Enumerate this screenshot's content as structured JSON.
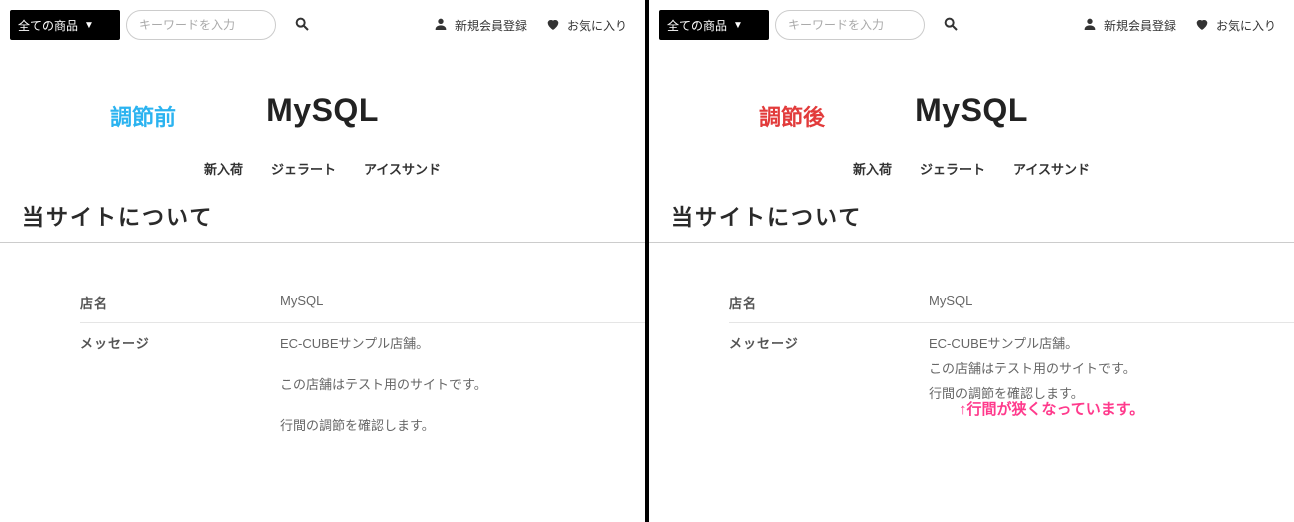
{
  "left": {
    "annotation": "調節前",
    "topbar": {
      "category_label": "全ての商品",
      "search_placeholder": "キーワードを入力",
      "register_label": "新規会員登録",
      "favorites_label": "お気に入り"
    },
    "brand": "MySQL",
    "nav": [
      "新入荷",
      "ジェラート",
      "アイスサンド"
    ],
    "page_title": "当サイトについて",
    "rows": {
      "shop_name_label": "店名",
      "shop_name_value": "MySQL",
      "message_label": "メッセージ",
      "message_lines": [
        "EC-CUBEサンプル店舗。",
        "この店舗はテスト用のサイトです。",
        "行間の調節を確認します。"
      ]
    }
  },
  "right": {
    "annotation": "調節後",
    "annotation2": "↑行間が狭くなっています。",
    "topbar": {
      "category_label": "全ての商品",
      "search_placeholder": "キーワードを入力",
      "register_label": "新規会員登録",
      "favorites_label": "お気に入り"
    },
    "brand": "MySQL",
    "nav": [
      "新入荷",
      "ジェラート",
      "アイスサンド"
    ],
    "page_title": "当サイトについて",
    "rows": {
      "shop_name_label": "店名",
      "shop_name_value": "MySQL",
      "message_label": "メッセージ",
      "message_lines": [
        "EC-CUBEサンプル店舗。",
        "この店舗はテスト用のサイトです。",
        "行間の調節を確認します。"
      ]
    }
  }
}
